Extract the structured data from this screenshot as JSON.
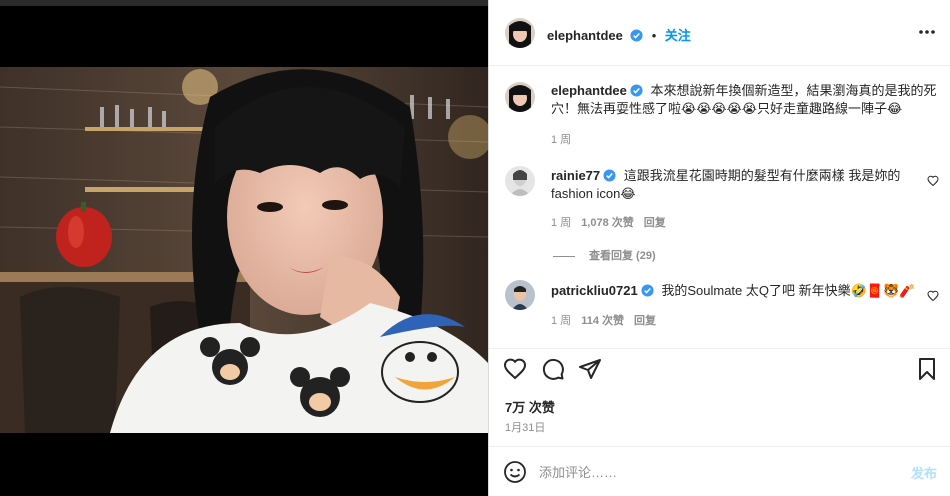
{
  "post": {
    "author": "elephantdee",
    "follow_label": "关注",
    "caption": "本來想說新年換個新造型，結果瀏海真的是我的死穴！無法再耍性感了啦😭😭😭😭😭只好走童趣路線一陣子😂",
    "caption_time": "1 周",
    "likes": "7万 次赞",
    "date": "1月31日"
  },
  "comments": [
    {
      "user": "rainie77",
      "text": "這跟我流星花園時期的髮型有什麼兩樣 我是妳的fashion icon😂",
      "time": "1 周",
      "likes": "1,078 次赞",
      "reply_label": "回复",
      "view_replies": "查看回复 (29)"
    },
    {
      "user": "patrickliu0721",
      "text": "我的Soulmate 太Q了吧 新年快樂🤣🧧🐯🧨",
      "time": "1 周",
      "likes": "114 次赞",
      "reply_label": "回复"
    }
  ],
  "add_comment": {
    "placeholder": "添加评论……",
    "post_label": "发布"
  },
  "colors": {
    "accent": "#0095f6",
    "verified": "#3897f0",
    "muted": "#8e8e8e",
    "post_disabled": "#b2dffc"
  },
  "icons": {
    "header": [
      "verified-badge-icon",
      "more-options-icon"
    ],
    "actions": [
      "heart-icon",
      "comment-icon",
      "share-icon",
      "bookmark-icon"
    ],
    "input": [
      "emoji-icon"
    ]
  }
}
